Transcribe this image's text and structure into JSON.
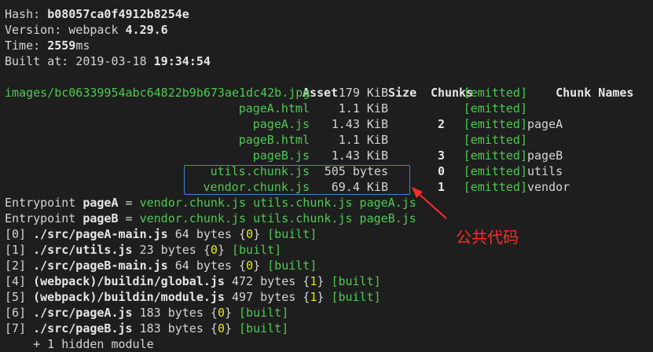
{
  "header": {
    "hash_label": "Hash: ",
    "hash_value": "b08057ca0f4912b8254e",
    "version_label": "Version: webpack ",
    "version_value": "4.29.6",
    "time_label": "Time: ",
    "time_value": "2559",
    "time_unit": "ms",
    "built_label": "Built at: 2019-03-18 ",
    "built_time": "19:34:54"
  },
  "table": {
    "columns": [
      "Asset",
      "Size",
      "Chunks",
      "",
      "Chunk Names"
    ],
    "rows": [
      {
        "asset": "images/bc06339954abc64822b9b673ae1dc42b.jpg",
        "size": "179 KiB",
        "chunks": "",
        "emitted": "[emitted]",
        "names": ""
      },
      {
        "asset": "pageA.html",
        "size": "1.1 KiB",
        "chunks": "",
        "emitted": "[emitted]",
        "names": ""
      },
      {
        "asset": "pageA.js",
        "size": "1.43 KiB",
        "chunks": "2",
        "emitted": "[emitted]",
        "names": "pageA"
      },
      {
        "asset": "pageB.html",
        "size": "1.1 KiB",
        "chunks": "",
        "emitted": "[emitted]",
        "names": ""
      },
      {
        "asset": "pageB.js",
        "size": "1.43 KiB",
        "chunks": "3",
        "emitted": "[emitted]",
        "names": "pageB"
      },
      {
        "asset": "utils.chunk.js",
        "size": "505 bytes",
        "chunks": "0",
        "emitted": "[emitted]",
        "names": "utils"
      },
      {
        "asset": "vendor.chunk.js",
        "size": "69.4 KiB",
        "chunks": "1",
        "emitted": "[emitted]",
        "names": "vendor"
      }
    ]
  },
  "entrypoints": [
    {
      "label": "Entrypoint ",
      "name": "pageA",
      "eq": " = ",
      "files": "vendor.chunk.js utils.chunk.js pageA.js"
    },
    {
      "label": "Entrypoint ",
      "name": "pageB",
      "eq": " = ",
      "files": "vendor.chunk.js utils.chunk.js pageB.js"
    }
  ],
  "modules": [
    {
      "id": "[0] ",
      "path": "./src/pageA-main.js",
      "size": " 64 bytes {",
      "chunk": "0",
      "close": "} ",
      "status": "[built]"
    },
    {
      "id": "[1] ",
      "path": "./src/utils.js",
      "size": " 23 bytes {",
      "chunk": "0",
      "close": "} ",
      "status": "[built]"
    },
    {
      "id": "[2] ",
      "path": "./src/pageB-main.js",
      "size": " 64 bytes {",
      "chunk": "0",
      "close": "} ",
      "status": "[built]"
    },
    {
      "id": "[4] ",
      "path": "(webpack)/buildin/global.js",
      "size": " 472 bytes {",
      "chunk": "1",
      "close": "} ",
      "status": "[built]"
    },
    {
      "id": "[5] ",
      "path": "(webpack)/buildin/module.js",
      "size": " 497 bytes {",
      "chunk": "1",
      "close": "} ",
      "status": "[built]"
    },
    {
      "id": "[6] ",
      "path": "./src/pageA.js",
      "size": " 183 bytes {",
      "chunk": "0",
      "close": "} ",
      "status": "[built]"
    },
    {
      "id": "[7] ",
      "path": "./src/pageB.js",
      "size": " 183 bytes {",
      "chunk": "0",
      "close": "} ",
      "status": "[built]"
    }
  ],
  "hidden_modules": "    + 1 hidden module",
  "annotation": {
    "label": "公共代码",
    "color": "#ff2a2a",
    "box_color": "#3c86d6"
  }
}
